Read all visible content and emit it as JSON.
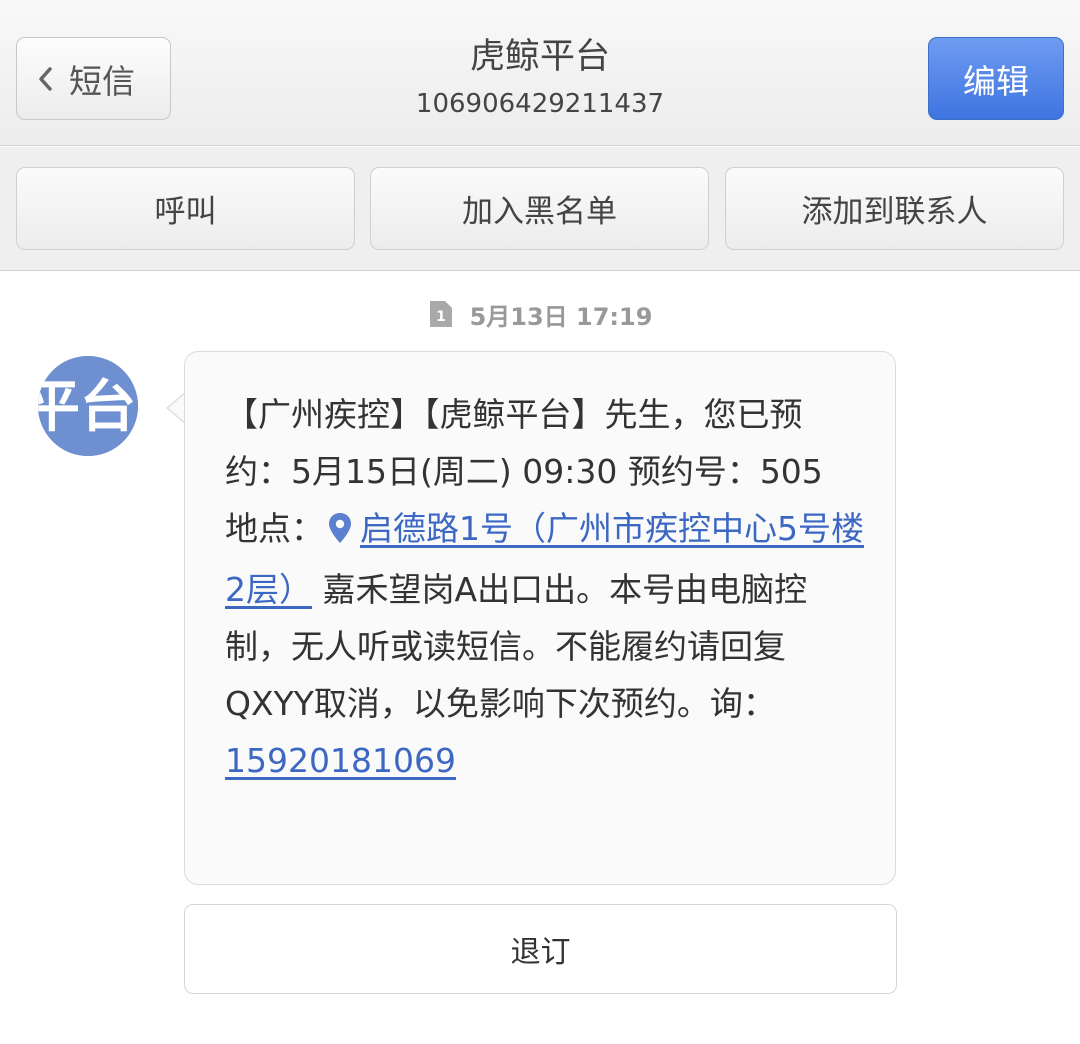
{
  "header": {
    "back_label": "短信",
    "title": "虎鲸平台",
    "subtitle": "106906429211437",
    "edit_label": "编辑"
  },
  "actions": {
    "call": "呼叫",
    "blacklist": "加入黑名单",
    "add_contact": "添加到联系人"
  },
  "thread": {
    "timestamp": "5月13日 17:19",
    "avatar_text": "平台",
    "message": {
      "text_intro": "【广州疾控】【虎鲸平台】先生，您已预约：5月15日(周二) 09:30 预约号：505 地点：",
      "address_link": "启德路1号（广州市疾控中心5号楼2层）",
      "text_after_address": " 嘉禾望岗A出口出。本号由电脑控制，无人听或读短信。不能履约请回复QXYY取消，以免影响下次预约。询：",
      "phone_link": "15920181069"
    },
    "unsubscribe_label": "退订"
  },
  "colors": {
    "accent_blue": "#4a7de6",
    "link_blue": "#3c68c3",
    "avatar_blue": "#6e8fd0"
  },
  "icons": {
    "back": "chevron-left-icon",
    "timestamp": "sim-card-icon",
    "address": "location-pin-icon"
  }
}
